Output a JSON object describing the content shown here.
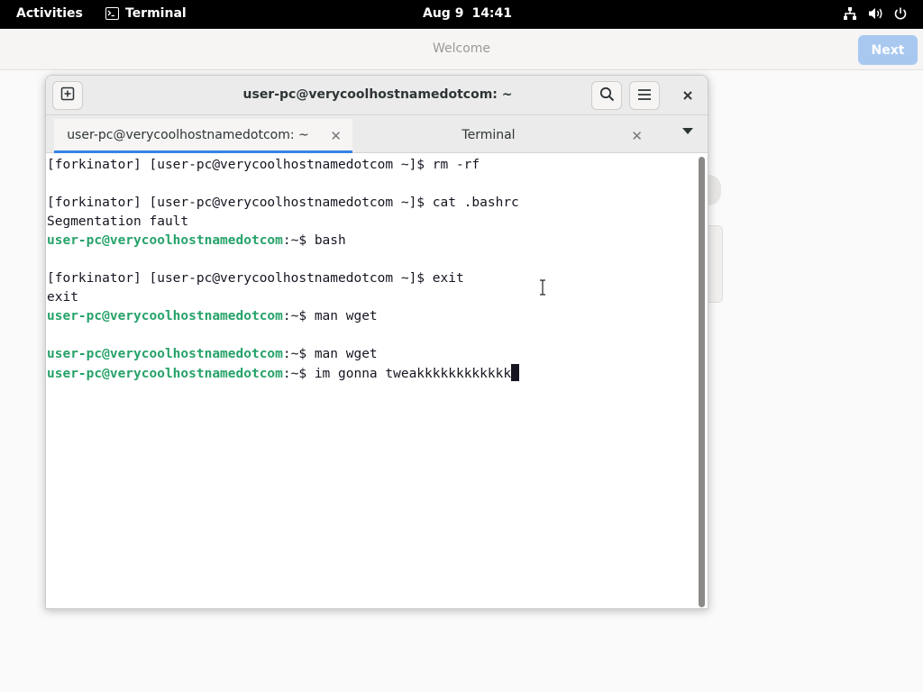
{
  "topbar": {
    "activities": "Activities",
    "app_name": "Terminal",
    "date": "Aug 9",
    "time": "14:41"
  },
  "welcome": {
    "title": "Welcome",
    "next_label": "Next"
  },
  "terminal": {
    "title": "user-pc@verycoolhostnamedotcom: ~",
    "tabs": [
      {
        "label": "user-pc@verycoolhostnamedotcom: ~",
        "active": true
      },
      {
        "label": "Terminal",
        "active": false
      }
    ],
    "lines": [
      {
        "text": "[forkinator] [user-pc@verycoolhostnamedotcom ~]$ rm -rf"
      },
      {
        "text": ""
      },
      {
        "text": "[forkinator] [user-pc@verycoolhostnamedotcom ~]$ cat .bashrc"
      },
      {
        "text": "Segmentation fault"
      },
      {
        "user": "user-pc@verycoolhostnamedotcom",
        "rest": ":~$ bash"
      },
      {
        "text": ""
      },
      {
        "text": "[forkinator] [user-pc@verycoolhostnamedotcom ~]$ exit"
      },
      {
        "text": "exit"
      },
      {
        "user": "user-pc@verycoolhostnamedotcom",
        "rest": ":~$ man wget"
      },
      {
        "text": ""
      },
      {
        "user": "user-pc@verycoolhostnamedotcom",
        "rest": ":~$ man wget"
      },
      {
        "user": "user-pc@verycoolhostnamedotcom",
        "rest": ":~$ im gonna tweakkkkkkkkkkkk",
        "cursor": true
      }
    ]
  },
  "colors": {
    "accent": "#3584e4",
    "prompt_user": "#26a269",
    "next_button": "#a8c8f0"
  }
}
